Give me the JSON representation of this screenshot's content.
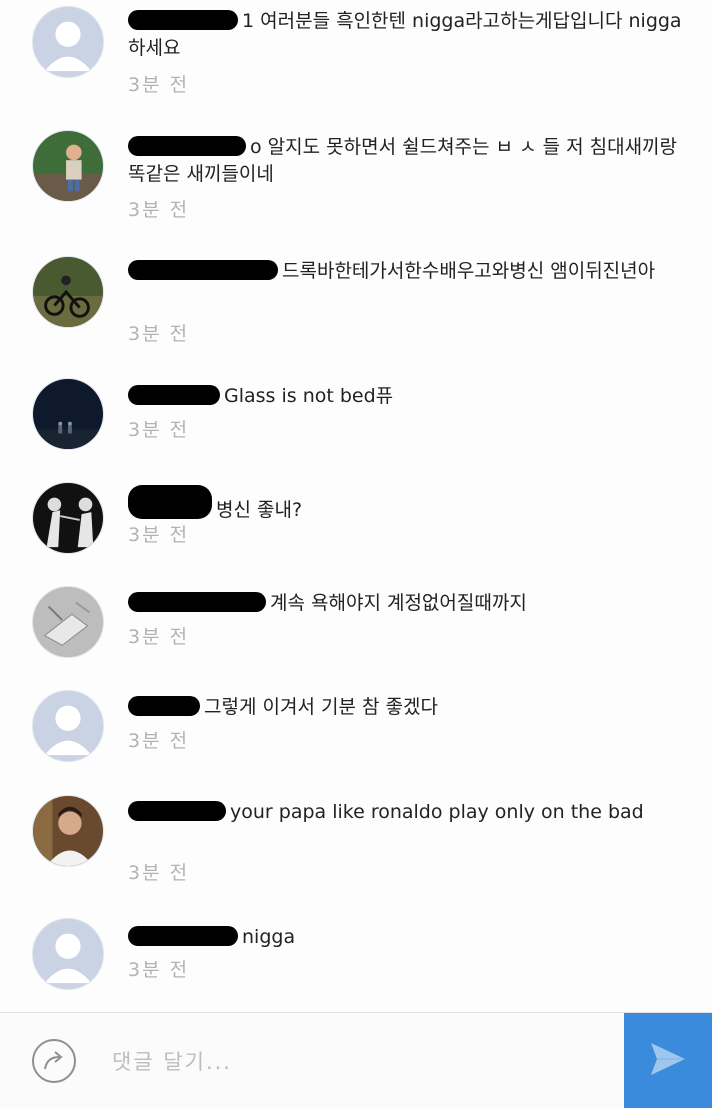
{
  "comments": [
    {
      "text": "1 여러분들 흑인한텐 nigga라고하는게답입니다 nigga 하세요",
      "time": "3분 전",
      "avatar": "default-avatar-icon"
    },
    {
      "text": "o 알지도 못하면서 쉴드쳐주는 ㅂ ㅅ 들 저 침대새끼랑 똑같은 새끼들이네",
      "time": "3분 전",
      "avatar": "child-photo"
    },
    {
      "text": "드록바한테가서한수배우고와병신 앰이뒤진년아",
      "time": "3분 전",
      "avatar": "cyclists-photo"
    },
    {
      "text": "Glass is not bed퓨",
      "time": "3분 전",
      "avatar": "night-scene-photo"
    },
    {
      "text": "병신 좋내?",
      "time": "3분 전",
      "avatar": "fencing-photo"
    },
    {
      "text": "계속 욕해야지 계정없어질때까지",
      "time": "3분 전",
      "avatar": "sketch-photo"
    },
    {
      "text": "그렇게 이겨서 기분 참 좋겠다",
      "time": "3분 전",
      "avatar": "default-avatar-icon"
    },
    {
      "text": "your papa like ronaldo play only on the bad",
      "time": "3분 전",
      "avatar": "person-photo"
    },
    {
      "text": "nigga",
      "time": "3분 전",
      "avatar": "default-avatar-icon"
    }
  ],
  "composer": {
    "placeholder": "댓글 달기...",
    "reply_icon": "reply-arrow-icon",
    "send_icon": "send-icon"
  },
  "colors": {
    "accent": "#3a8bdc",
    "timestamp": "#b3b3b3",
    "text": "#222222"
  }
}
